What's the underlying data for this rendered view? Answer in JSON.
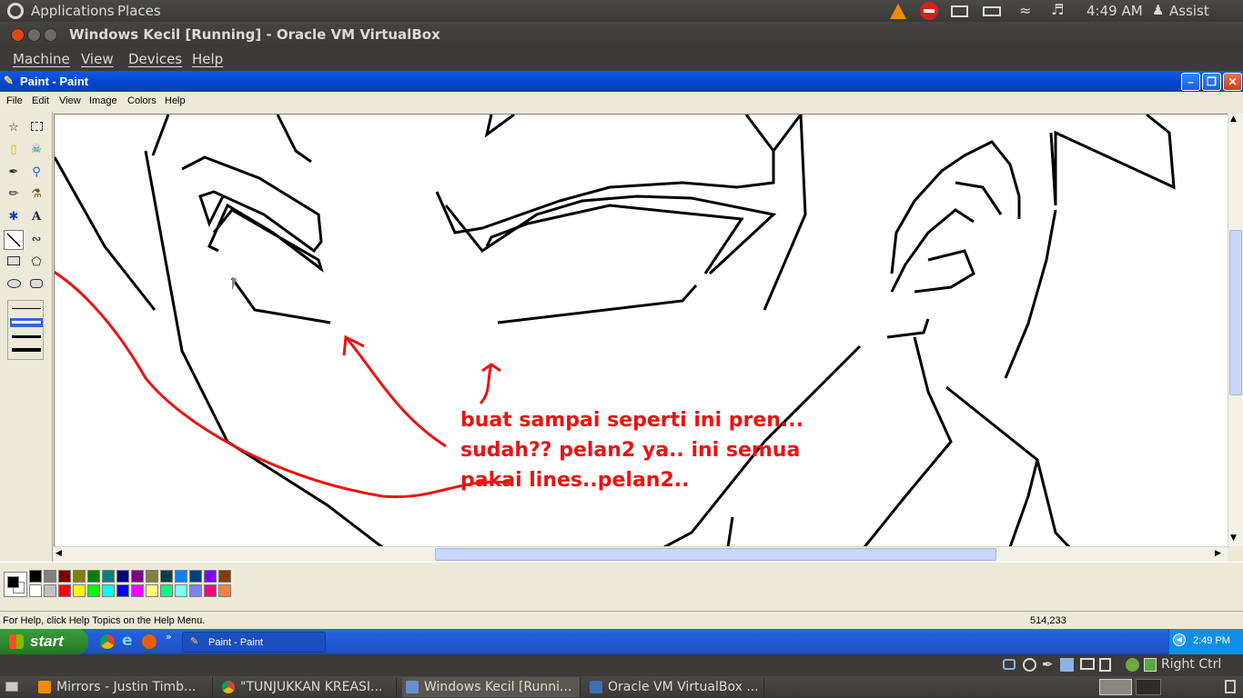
{
  "top_panel": {
    "menus": [
      "Applications",
      "Places"
    ],
    "clock": "4:49 AM",
    "user": "Assist"
  },
  "vbox_window": {
    "title": "Windows Kecil [Running] - Oracle VM VirtualBox",
    "menus": [
      "Machine",
      "View",
      "Devices",
      "Help"
    ],
    "host_key": "Right Ctrl"
  },
  "paint": {
    "title": "Paint - Paint",
    "menus": [
      "File",
      "Edit",
      "View",
      "Image",
      "Colors",
      "Help"
    ],
    "status_help": "For Help, click Help Topics on the Help Menu.",
    "status_coords": "514,233",
    "annotation": [
      "buat sampai seperti ini pren...",
      "sudah?? pelan2 ya.. ini semua",
      "pakai lines..pelan2.."
    ],
    "palette_top": [
      "#000000",
      "#808080",
      "#800000",
      "#808000",
      "#008000",
      "#008080",
      "#000080",
      "#800080",
      "#808040",
      "#004040",
      "#0080ff",
      "#004080",
      "#8000ff",
      "#804000"
    ],
    "palette_bottom": [
      "#ffffff",
      "#c0c0c0",
      "#ff0000",
      "#ffff00",
      "#00ff00",
      "#00ffff",
      "#0000ff",
      "#ff00ff",
      "#ffff80",
      "#00ff80",
      "#80ffff",
      "#8080ff",
      "#ff0080",
      "#ff8040"
    ],
    "drawing_color": "#000000",
    "annotation_color": "#ee1111"
  },
  "xp_taskbar": {
    "start_label": "start",
    "task_label": "Paint - Paint",
    "clock": "2:49 PM"
  },
  "bottom_panel": {
    "tasks": [
      {
        "label": "Mirrors - Justin Timb...",
        "icon": "vlc-icon"
      },
      {
        "label": "\"TUNJUKKAN KREASI...",
        "icon": "chrome-icon"
      },
      {
        "label": "Windows Kecil [Runni...",
        "icon": "virtualbox-icon"
      },
      {
        "label": "Oracle VM VirtualBox ...",
        "icon": "virtualbox-manager-icon"
      }
    ]
  }
}
